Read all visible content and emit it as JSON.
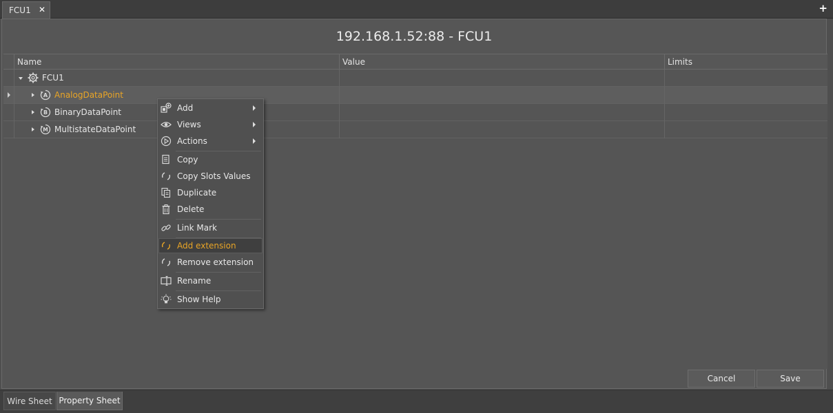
{
  "top_tab": {
    "label": "FCU1",
    "close_glyph": "✕"
  },
  "add_tab_glyph": "+",
  "panel_title": "192.168.1.52:88 - FCU1",
  "columns": {
    "name": "Name",
    "value": "Value",
    "limits": "Limits"
  },
  "tree": {
    "root": {
      "label": "FCU1",
      "icon": "gear-icon"
    },
    "children": [
      {
        "label": "AnalogDataPoint",
        "badge": "A",
        "icon": "analog-point-icon"
      },
      {
        "label": "BinaryDataPoint",
        "badge": "B",
        "icon": "binary-point-icon"
      },
      {
        "label": "MultistateDataPoint",
        "badge": "M",
        "icon": "multistate-point-icon"
      }
    ]
  },
  "context_menu": {
    "items": [
      {
        "label": "Add",
        "icon": "add-component-icon",
        "submenu": true
      },
      {
        "label": "Views",
        "icon": "eye-icon",
        "submenu": true
      },
      {
        "label": "Actions",
        "icon": "play-icon",
        "submenu": true
      },
      {
        "label": "Copy",
        "icon": "copy-icon"
      },
      {
        "label": "Copy Slots Values",
        "icon": "copy-slots-icon"
      },
      {
        "label": "Duplicate",
        "icon": "duplicate-icon"
      },
      {
        "label": "Delete",
        "icon": "trash-icon"
      },
      {
        "label": "Link Mark",
        "icon": "link-icon"
      },
      {
        "label": "Add extension",
        "icon": "add-extension-icon",
        "hovered": true
      },
      {
        "label": "Remove extension",
        "icon": "remove-extension-icon"
      },
      {
        "label": "Rename",
        "icon": "rename-icon"
      },
      {
        "label": "Show Help",
        "icon": "lightbulb-icon"
      }
    ]
  },
  "footer": {
    "cancel": "Cancel",
    "save": "Save"
  },
  "bottom_tabs": [
    {
      "label": "Wire Sheet",
      "active": false
    },
    {
      "label": "Property Sheet",
      "active": true
    }
  ],
  "colors": {
    "highlight": "#e9a526",
    "background": "#4f4f4f"
  }
}
